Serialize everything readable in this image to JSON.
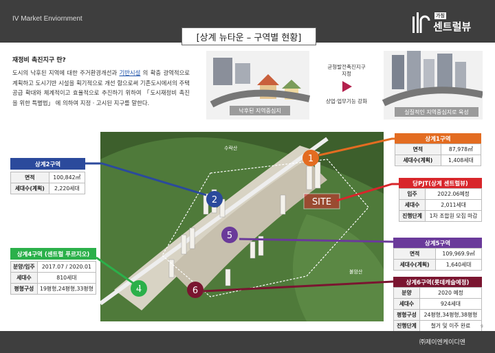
{
  "header": {
    "section_label": "IV Market Enviornment",
    "logo_badge": "가칭",
    "logo_text": "센트럴뷰",
    "title": "[상계 뉴타운 – 구역별 현황]"
  },
  "intro": {
    "title": "재정비 촉진지구 란?",
    "pre": "도시의 낙후된 지역에 대한 주거환경개선과 ",
    "highlight": "기반시설",
    "post": " 의 확충 광역적으로 계획하고 도시기반 시설을 획기적으로 개선 함으로써 기존도시에서의 주택공급 확대와 체계적이고 효율적으로 추진하기 위하여 「도시재정비 촉진을 위한 특별법」 에 의하여 지정ㆍ고시된 지구를 말한다."
  },
  "illustration": {
    "before_label": "낙후된 지역중심지",
    "arrow_top": "균형발전촉진지구",
    "arrow_top2": "지정",
    "arrow_bottom": "상업·업무기능 강화",
    "after_label": "실질적인 지역중심지로 육성"
  },
  "map": {
    "mountain_top": "수락산",
    "mountain_right": "불암산",
    "site_label": "SITE",
    "markers": [
      "1",
      "2",
      "4",
      "5",
      "6"
    ]
  },
  "zones": {
    "z1": {
      "title": "상계1구역",
      "rows": [
        [
          "면적",
          "87,978㎡"
        ],
        [
          "세대수(계획)",
          "1,408세대"
        ]
      ]
    },
    "z2": {
      "title": "상계2구역",
      "rows": [
        [
          "면적",
          "100,842㎡"
        ],
        [
          "세대수(계획)",
          "2,220세대"
        ]
      ]
    },
    "site": {
      "title": "당PJT(상계 센트럴뷰)",
      "rows": [
        [
          "입주",
          "2022.06예정"
        ],
        [
          "세대수",
          "2,011세대"
        ],
        [
          "진행단계",
          "1차 조합원 모집 마감"
        ]
      ]
    },
    "z4": {
      "title": "상계4구역 (센트럴 푸르지오)",
      "rows": [
        [
          "분양/입주",
          "2017.07 / 2020.01"
        ],
        [
          "세대수",
          "810세대"
        ],
        [
          "평형구성",
          "19평형,24평형,33평형"
        ]
      ]
    },
    "z5": {
      "title": "상계5구역",
      "rows": [
        [
          "면적",
          "109,969.9㎡"
        ],
        [
          "세대수(계획)",
          "1,640세대"
        ]
      ]
    },
    "z6": {
      "title": "상계6구역(롯데캐슬예정)",
      "rows": [
        [
          "분양",
          "2020 예정"
        ],
        [
          "세대수",
          "924세대"
        ],
        [
          "평형구성",
          "24평형,34평형,38평형"
        ],
        [
          "진행단계",
          "철거 및 이주 완료"
        ]
      ]
    }
  },
  "footer": {
    "company": "㈜제이엔케이디앤",
    "page": "9"
  },
  "colors": {
    "z1": "#e36c21",
    "z2": "#2b4a9c",
    "site": "#d8262b",
    "z4": "#2bb04a",
    "z5": "#6a3a9a",
    "z6": "#7a1530"
  }
}
